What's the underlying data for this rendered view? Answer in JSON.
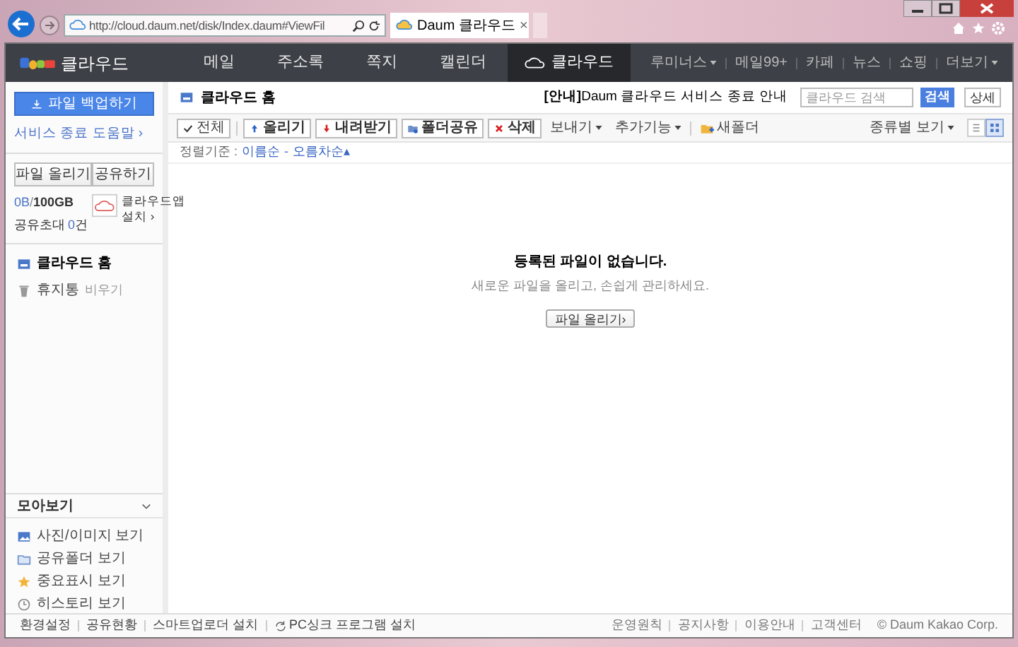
{
  "browser": {
    "url": "http://cloud.daum.net/disk/Index.daum#ViewFil",
    "tab_title": "Daum 클라우드",
    "tab_close": "×"
  },
  "nav": {
    "logo": "클라우드",
    "items": [
      {
        "label": "메일",
        "selected": false
      },
      {
        "label": "주소록",
        "selected": false
      },
      {
        "label": "쪽지",
        "selected": false
      },
      {
        "label": "캘린더",
        "selected": false
      },
      {
        "label": "클라우드",
        "selected": true
      }
    ],
    "links": [
      {
        "label": "루미너스",
        "dropdown": true
      },
      {
        "label": "메일99+",
        "dropdown": false
      },
      {
        "label": "카페",
        "dropdown": false
      },
      {
        "label": "뉴스",
        "dropdown": false
      },
      {
        "label": "쇼핑",
        "dropdown": false
      },
      {
        "label": "더보기",
        "dropdown": true
      }
    ]
  },
  "sidebar": {
    "backup_button": "파일 백업하기",
    "help_link": "서비스 종료 도움말 ›",
    "actions": [
      "파일 올리기",
      "공유하기"
    ],
    "storage": {
      "used": "0B",
      "separator": "/",
      "total": "100GB"
    },
    "invites": {
      "label": "공유초대",
      "count": "0",
      "unit": "건"
    },
    "app_promo": [
      "클라우드앱",
      "설치 ›"
    ],
    "tree": [
      {
        "label": "클라우드 홈",
        "selected": true,
        "kind": "home"
      },
      {
        "label": "휴지통",
        "selected": false,
        "kind": "trash",
        "action": "비우기"
      }
    ],
    "collection": {
      "title": "모아보기",
      "expanded": true,
      "items": [
        {
          "label": "사진/이미지 보기",
          "kind": "photo"
        },
        {
          "label": "공유폴더 보기",
          "kind": "folder"
        },
        {
          "label": "중요표시 보기",
          "kind": "star"
        },
        {
          "label": "히스토리 보기",
          "kind": "clock"
        }
      ]
    }
  },
  "content": {
    "title": "클라우드 홈",
    "notice": "**[안내]**Daum 클라우드 서비스 종료 안내",
    "search": {
      "placeholder": "클라우드 검색",
      "button": "검색",
      "detail": "상세"
    },
    "toolbar": [
      {
        "label": "전체",
        "kind": "check"
      },
      {
        "label": "올리기",
        "kind": "upload"
      },
      {
        "label": "내려받기",
        "kind": "download"
      },
      {
        "label": "폴더공유",
        "kind": "share"
      },
      {
        "label": "삭제",
        "kind": "delete"
      },
      {
        "label": "보내기",
        "kind": "menu"
      },
      {
        "label": "추가기능",
        "kind": "menu"
      },
      {
        "label": "새폴더",
        "kind": "new-folder"
      }
    ],
    "view_menu": "종류별 보기",
    "views": [
      {
        "kind": "list",
        "selected": false
      },
      {
        "kind": "grid",
        "selected": true
      }
    ],
    "sort": {
      "label": "정렬기준 :",
      "options": [
        {
          "label": "이름순",
          "selected": true
        },
        {
          "label": "오름차순▴",
          "selected": true
        }
      ],
      "separator": "-"
    },
    "empty": {
      "title": "등록된 파일이 없습니다.",
      "subtitle": "새로운 파일을 올리고, 손쉽게 관리하세요.",
      "button": "파일 올리기›"
    }
  },
  "footer": {
    "left": [
      {
        "label": "환경설정",
        "kind": "link"
      },
      {
        "label": "공유현황",
        "kind": "link"
      },
      {
        "label": "스마트업로더 설치",
        "kind": "link"
      },
      {
        "label": "PC싱크 프로그램 설치",
        "kind": "sync"
      }
    ],
    "right": [
      "운영원칙",
      "공지사항",
      "이용안내",
      "고객센터"
    ],
    "copyright": "© Daum Kakao Corp."
  }
}
